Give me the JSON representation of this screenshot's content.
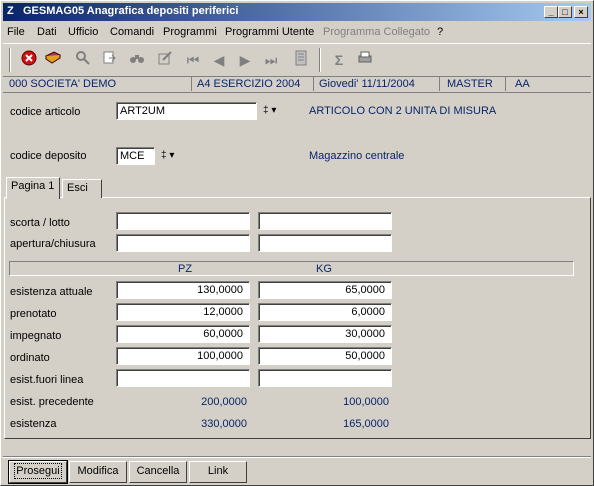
{
  "window": {
    "title": "GESMAG05  Anagrafica depositi periferici",
    "icon": "Z"
  },
  "titlebar_buttons": {
    "minimize": "_",
    "maximize": "□",
    "close": "×"
  },
  "menu": [
    "File",
    "Dati",
    "Ufficio",
    "Comandi",
    "Programmi",
    "Programmi Utente",
    "Programma Collegato",
    "?"
  ],
  "toolbar": {
    "icons": [
      "exit-icon",
      "book-icon",
      "search-icon",
      "export-icon",
      "binoculars-icon",
      "edit-icon",
      "first-record-icon",
      "prev-record-icon",
      "next-record-icon",
      "last-record-icon",
      "document-icon",
      "sigma-icon",
      "print-icon"
    ],
    "glyphs": {
      "first": "⏮",
      "prev": "◀",
      "next": "▶",
      "last": "⏭",
      "sigma": "Σ"
    }
  },
  "status": {
    "company": "000 SOCIETA' DEMO",
    "year": "A4 ESERCIZIO 2004",
    "date": "Giovedi'  11/11/2004",
    "user": "MASTER",
    "code": "AA"
  },
  "form": {
    "articolo_label": "codice articolo",
    "articolo_value": "ART2UM",
    "articolo_desc": "ARTICOLO CON 2 UNITA DI MISURA",
    "deposito_label": "codice deposito",
    "deposito_value": "MCE",
    "deposito_desc": "Magazzino centrale",
    "dd_glyph": "‡ ▾"
  },
  "tabs": [
    "Pagina 1",
    "Esci"
  ],
  "page1": {
    "scorta_label": "scorta / lotto",
    "apertura_label": "apertura/chiusura",
    "col_pz": "PZ",
    "col_kg": "KG",
    "rows": [
      {
        "label": "esistenza attuale",
        "pz": "130,0000",
        "kg": "65,0000"
      },
      {
        "label": "prenotato",
        "pz": "12,0000",
        "kg": "6,0000"
      },
      {
        "label": "impegnato",
        "pz": "60,0000",
        "kg": "30,0000"
      },
      {
        "label": "ordinato",
        "pz": "100,0000",
        "kg": "50,0000"
      },
      {
        "label": "esist.fuori linea",
        "pz": "",
        "kg": ""
      }
    ],
    "precedente_label": "esist. precedente",
    "precedente_pz": "200,0000",
    "precedente_kg": "100,0000",
    "esistenza_label": "esistenza",
    "esistenza_pz": "330,0000",
    "esistenza_kg": "165,0000"
  },
  "buttons": [
    "Prosegui",
    "Modifica",
    "Cancella",
    "Link"
  ]
}
